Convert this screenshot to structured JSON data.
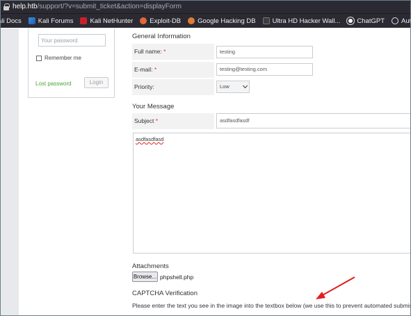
{
  "browser": {
    "url_host": "help.htb",
    "url_path": "/support/?v=submit_ticket&action=displayForm",
    "bookmarks": [
      {
        "label": "ali Docs",
        "icon": "kali-docs-icon"
      },
      {
        "label": "Kali Forums",
        "icon": "kali-forums-icon"
      },
      {
        "label": "Kali NetHunter",
        "icon": "nethunter-icon"
      },
      {
        "label": "Exploit-DB",
        "icon": "exploit-db-icon"
      },
      {
        "label": "Google Hacking DB",
        "icon": "ghdb-icon"
      },
      {
        "label": "Ultra HD Hacker Wall...",
        "icon": "wallpaper-icon"
      },
      {
        "label": "ChatGPT",
        "icon": "chatgpt-icon"
      },
      {
        "label": "Autonomia Hacker",
        "icon": "globe-icon"
      }
    ]
  },
  "login": {
    "password_placeholder": "Your password",
    "remember_label": "Remember me",
    "lost_password": "Lost password",
    "login_button": "Login"
  },
  "form": {
    "general_title": "General Information",
    "full_name_label": "Full name:",
    "full_name_value": "testing",
    "email_label": "E-mail:",
    "email_value": "testing@testing.com",
    "priority_label": "Priority:",
    "priority_value": "Low",
    "message_title": "Your Message",
    "subject_label": "Subject",
    "subject_value": "asdfasdfasdf",
    "message_value": "asdfasdfasd",
    "attachments_title": "Attachments",
    "browse_button": "Browse...",
    "attached_file": "phpshell.php",
    "captcha_title": "CAPTCHA Verification",
    "captcha_text": "Please enter the text you see in the image into the textbox below (we use this to prevent automated submissions).",
    "required_mark": "*"
  },
  "colors": {
    "browser_bar": "#2b2a33",
    "required": "#d43333",
    "annotation_arrow": "#e02020",
    "link_green": "#4aa33a"
  }
}
